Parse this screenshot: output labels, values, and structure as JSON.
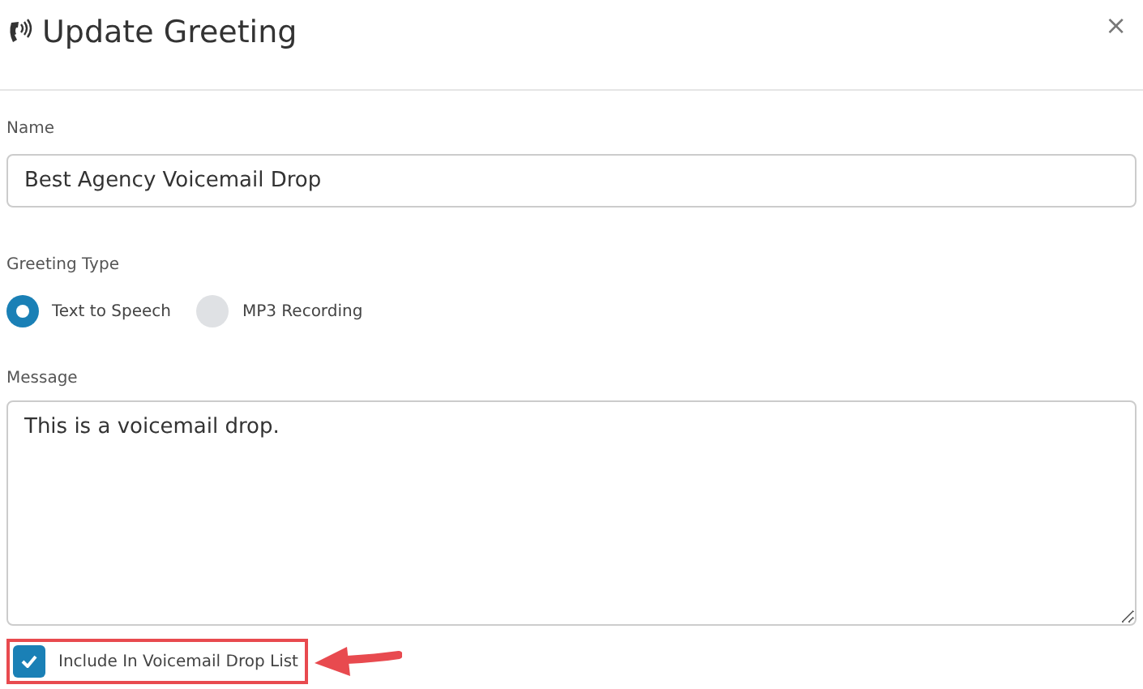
{
  "dialog": {
    "title": "Update Greeting",
    "close": "×"
  },
  "name_field": {
    "label": "Name",
    "value": "Best Agency Voicemail Drop"
  },
  "greeting_type": {
    "label": "Greeting Type",
    "options": [
      {
        "label": "Text to Speech",
        "selected": true
      },
      {
        "label": "MP3 Recording",
        "selected": false
      }
    ]
  },
  "message_field": {
    "label": "Message",
    "value": "This is a voicemail drop."
  },
  "include_checkbox": {
    "label": "Include In Voicemail Drop List",
    "checked": true,
    "highlighted": true
  }
}
